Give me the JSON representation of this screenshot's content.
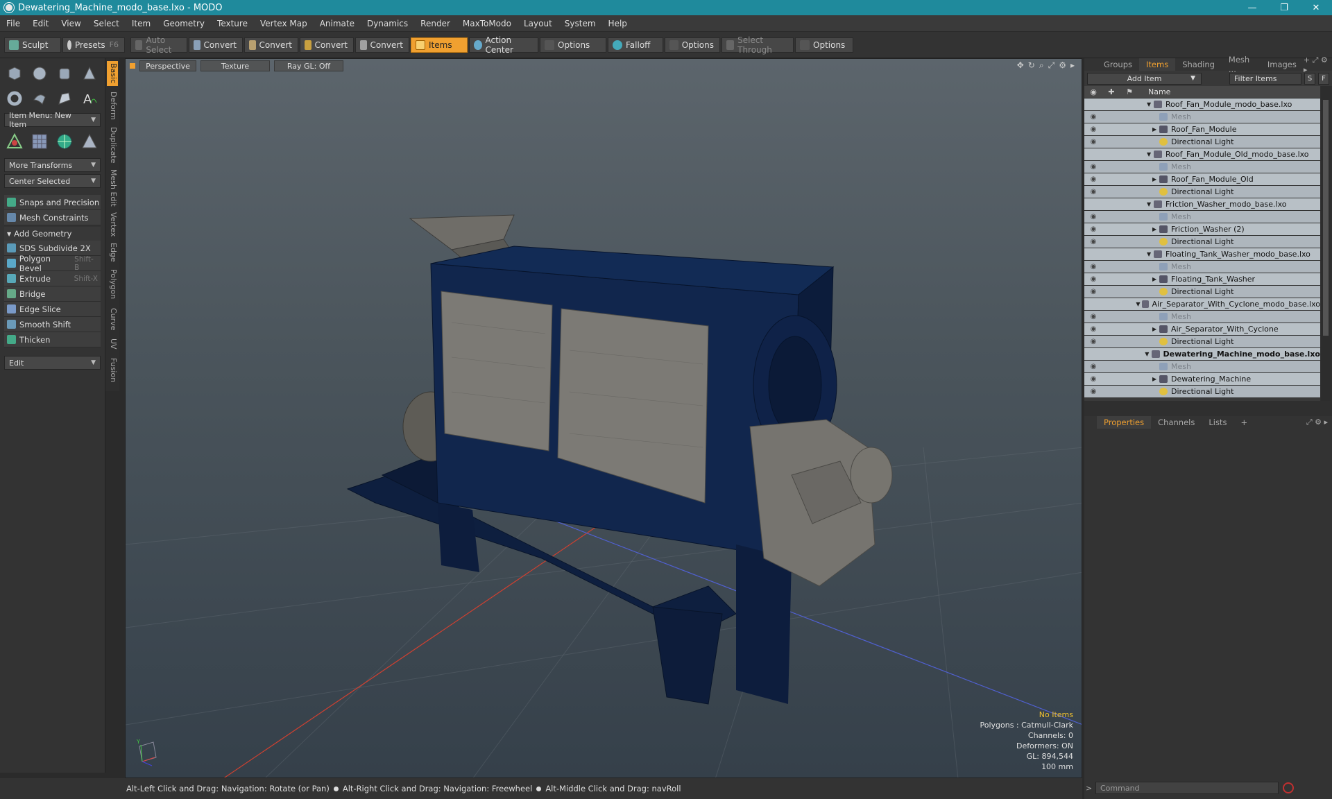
{
  "window": {
    "title": "Dewatering_Machine_modo_base.lxo - MODO",
    "controls": [
      "—",
      "❐",
      "✕"
    ]
  },
  "menu": [
    "File",
    "Edit",
    "View",
    "Select",
    "Item",
    "Geometry",
    "Texture",
    "Vertex Map",
    "Animate",
    "Dynamics",
    "Render",
    "MaxToModo",
    "Layout",
    "System",
    "Help"
  ],
  "toolbar": {
    "sculpt": "Sculpt",
    "presets": "Presets",
    "presets_key": "F6",
    "auto_select": "Auto Select",
    "convert1": "Convert",
    "convert2": "Convert",
    "convert3": "Convert",
    "convert4": "Convert",
    "items": "Items",
    "action_center": "Action Center",
    "options1": "Options",
    "falloff": "Falloff",
    "options2": "Options",
    "select_through": "Select Through",
    "options3": "Options"
  },
  "leftpanel": {
    "item_menu": "Item Menu: New Item",
    "more_transforms": "More Transforms",
    "center_selected": "Center Selected",
    "snaps": "Snaps and Precision",
    "mesh_constraints": "Mesh Constraints",
    "add_geometry": "Add Geometry",
    "tools": [
      {
        "label": "SDS Subdivide 2X",
        "key": ""
      },
      {
        "label": "Polygon Bevel",
        "key": "Shift-B"
      },
      {
        "label": "Extrude",
        "key": "Shift-X"
      },
      {
        "label": "Bridge",
        "key": ""
      },
      {
        "label": "Edge Slice",
        "key": ""
      },
      {
        "label": "Smooth Shift",
        "key": ""
      },
      {
        "label": "Thicken",
        "key": ""
      }
    ],
    "edit_dropdown": "Edit",
    "vtabs": [
      "Basic",
      "Deform",
      "Duplicate",
      "Mesh Edit",
      "Vertex",
      "Edge",
      "Polygon",
      "Curve",
      "UV",
      "Fusion"
    ]
  },
  "viewport": {
    "tabs": [
      "Perspective",
      "Texture",
      "Ray GL: Off"
    ],
    "stats": {
      "no_items": "No Items",
      "polygons": "Polygons : Catmull-Clark",
      "channels": "Channels: 0",
      "deformers": "Deformers: ON",
      "gl": "GL: 894,544",
      "scale": "100 mm"
    }
  },
  "status": {
    "hint1": "Alt-Left Click and Drag: Navigation: Rotate (or Pan)",
    "hint2": "Alt-Right Click and Drag: Navigation: Freewheel",
    "hint3": "Alt-Middle Click and Drag: navRoll"
  },
  "items_panel": {
    "tabs": [
      "Groups",
      "Items",
      "Shading",
      "Mesh ...",
      "Images"
    ],
    "add_item": "Add Item",
    "filter_placeholder": "Filter Items",
    "s_btn": "S",
    "f_btn": "F",
    "column_name": "Name",
    "rows": [
      {
        "label": "Roof_Fan_Module_modo_base.lxo",
        "level": 0,
        "type": "scene"
      },
      {
        "label": "Mesh",
        "level": 1,
        "type": "mesh"
      },
      {
        "label": "Roof_Fan_Module",
        "level": 1,
        "type": "item"
      },
      {
        "label": "Directional Light",
        "level": 1,
        "type": "light"
      },
      {
        "label": "Roof_Fan_Module_Old_modo_base.lxo",
        "level": 0,
        "type": "scene"
      },
      {
        "label": "Mesh",
        "level": 1,
        "type": "mesh"
      },
      {
        "label": "Roof_Fan_Module_Old",
        "level": 1,
        "type": "item"
      },
      {
        "label": "Directional Light",
        "level": 1,
        "type": "light"
      },
      {
        "label": "Friction_Washer_modo_base.lxo",
        "level": 0,
        "type": "scene"
      },
      {
        "label": "Mesh",
        "level": 1,
        "type": "mesh"
      },
      {
        "label": "Friction_Washer (2)",
        "level": 1,
        "type": "item"
      },
      {
        "label": "Directional Light",
        "level": 1,
        "type": "light"
      },
      {
        "label": "Floating_Tank_Washer_modo_base.lxo",
        "level": 0,
        "type": "scene"
      },
      {
        "label": "Mesh",
        "level": 1,
        "type": "mesh"
      },
      {
        "label": "Floating_Tank_Washer",
        "level": 1,
        "type": "item"
      },
      {
        "label": "Directional Light",
        "level": 1,
        "type": "light"
      },
      {
        "label": "Air_Separator_With_Cyclone_modo_base.lxo",
        "level": 0,
        "type": "scene"
      },
      {
        "label": "Mesh",
        "level": 1,
        "type": "mesh"
      },
      {
        "label": "Air_Separator_With_Cyclone",
        "level": 1,
        "type": "item"
      },
      {
        "label": "Directional Light",
        "level": 1,
        "type": "light"
      },
      {
        "label": "Dewatering_Machine_modo_base.lxo",
        "level": 0,
        "type": "scene",
        "bold": true
      },
      {
        "label": "Mesh",
        "level": 1,
        "type": "mesh"
      },
      {
        "label": "Dewatering_Machine",
        "level": 1,
        "type": "item"
      },
      {
        "label": "Directional Light",
        "level": 1,
        "type": "light"
      }
    ]
  },
  "properties_panel": {
    "tabs": [
      "Properties",
      "Channels",
      "Lists"
    ]
  },
  "command": {
    "placeholder": "Command"
  },
  "colors": {
    "accent": "#f0a030",
    "titlebar": "#1f8a9c",
    "machine_body": "#0e1f3f"
  }
}
